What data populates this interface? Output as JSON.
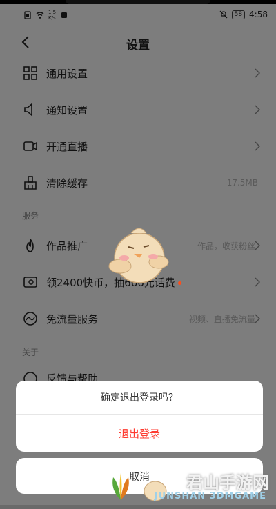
{
  "status_bar": {
    "speed": "1.5\nK/s",
    "battery": "58",
    "time": "4:58"
  },
  "header": {
    "title": "设置"
  },
  "menu_items": [
    {
      "label": "通用设置",
      "icon": "grid-icon"
    },
    {
      "label": "通知设置",
      "icon": "speaker-icon"
    },
    {
      "label": "开通直播",
      "icon": "video-camera-icon"
    },
    {
      "label": "清除缓存",
      "icon": "broom-icon",
      "value": "17.5MB"
    }
  ],
  "services": {
    "section_label": "服务",
    "items": [
      {
        "label": "作品推广",
        "icon": "flame-icon",
        "value": "作品，收获粉丝"
      },
      {
        "label": "领2400快币，抽666元话费",
        "icon": "coin-card-icon"
      },
      {
        "label": "免流量服务",
        "icon": "wave-icon",
        "value": "视频、直播免流量"
      }
    ]
  },
  "about": {
    "section_label": "关于",
    "partial_item": "反馈与帮助"
  },
  "dialog": {
    "question": "确定退出登录吗？",
    "logout": "退出登录",
    "cancel": "取消"
  },
  "watermark": {
    "text": "君山手游网",
    "sub": "JUNSHAN 3DMGAME"
  },
  "colors": {
    "overlay": "#7d7d7d",
    "danger": "#fe3b30",
    "badge_dot": "#ff4d1a"
  }
}
